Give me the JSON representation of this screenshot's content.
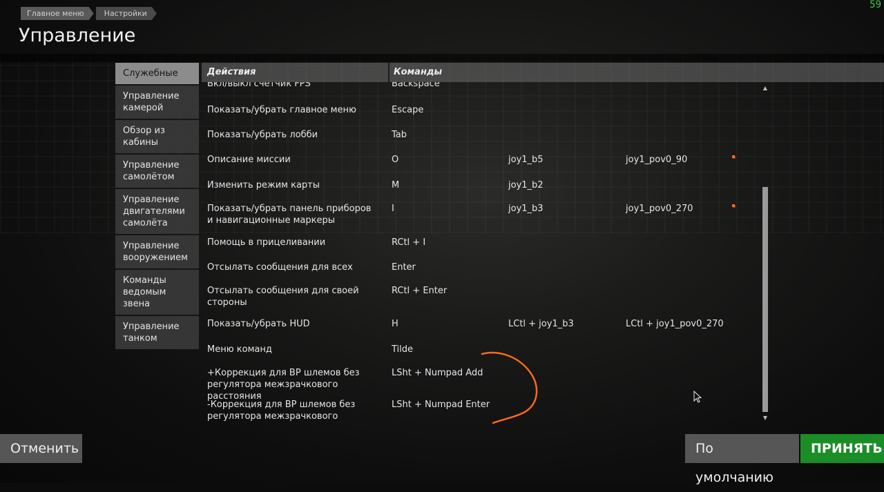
{
  "fps": "59",
  "breadcrumb": [
    "Главное меню",
    "Настройки"
  ],
  "page_title": "Управление",
  "sidebar": {
    "items": [
      {
        "lines": [
          "Служебные"
        ],
        "active": true
      },
      {
        "lines": [
          "Управление",
          "камерой"
        ],
        "active": false
      },
      {
        "lines": [
          "Обзор из",
          "кабины"
        ],
        "active": false
      },
      {
        "lines": [
          "Управление",
          "самолётом"
        ],
        "active": false
      },
      {
        "lines": [
          "Управление",
          "двигателями",
          "самолёта"
        ],
        "active": false
      },
      {
        "lines": [
          "Управление",
          "вооружением"
        ],
        "active": false
      },
      {
        "lines": [
          "Команды",
          "ведомым звена"
        ],
        "active": false
      },
      {
        "lines": [
          "Управление",
          "танком"
        ],
        "active": false
      }
    ]
  },
  "table": {
    "col_actions": "Действия",
    "col_commands": "Команды",
    "rows": [
      {
        "action": "Вкл/выкл счётчик FPS",
        "k1": "Backspace",
        "k2": "",
        "k3": "",
        "flag": false
      },
      {
        "action": "Показать/убрать главное меню",
        "k1": "Escape",
        "k2": "",
        "k3": "",
        "flag": false
      },
      {
        "action": "Показать/убрать лобби",
        "k1": "Tab",
        "k2": "",
        "k3": "",
        "flag": false
      },
      {
        "action": "Описание миссии",
        "k1": "O",
        "k2": "joy1_b5",
        "k3": "joy1_pov0_90",
        "flag": true
      },
      {
        "action": "Изменить режим карты",
        "k1": "M",
        "k2": "joy1_b2",
        "k3": "",
        "flag": false
      },
      {
        "action": "Показать/убрать панель приборов и навигационные маркеры",
        "k1": "I",
        "k2": "joy1_b3",
        "k3": "joy1_pov0_270",
        "flag": true
      },
      {
        "action": "Помощь в прицеливании",
        "k1": "RCtl + I",
        "k2": "",
        "k3": "",
        "flag": false
      },
      {
        "action": "Отсылать сообщения для всех",
        "k1": "Enter",
        "k2": "",
        "k3": "",
        "flag": false
      },
      {
        "action": "Отсылать сообщения для своей стороны",
        "k1": "RCtl + Enter",
        "k2": "",
        "k3": "",
        "flag": false
      },
      {
        "action": "Показать/убрать HUD",
        "k1": "H",
        "k2": "LCtl + joy1_b3",
        "k3": "LCtl + joy1_pov0_270",
        "flag": false
      },
      {
        "action": "Меню команд",
        "k1": "Tilde",
        "k2": "",
        "k3": "",
        "flag": false
      },
      {
        "action": "+Коррекция для ВР шлемов без регулятора межзрачкового расстояния",
        "k1": "LSht + Numpad Add",
        "k2": "",
        "k3": "",
        "flag": false
      },
      {
        "action": "-Коррекция для ВР шлемов без регулятора межзрачкового расстояния",
        "k1": "LSht + Numpad Enter",
        "k2": "",
        "k3": "",
        "flag": false
      }
    ]
  },
  "buttons": {
    "cancel": "Отменить",
    "default": "По умолчанию",
    "accept": "ПРИНЯТЬ"
  },
  "colors": {
    "accept": "#1a8d26",
    "button": "#565656",
    "active_tab": "#8c8c8c",
    "fps": "#3ecb3e",
    "annotation": "#ff6a1a"
  }
}
